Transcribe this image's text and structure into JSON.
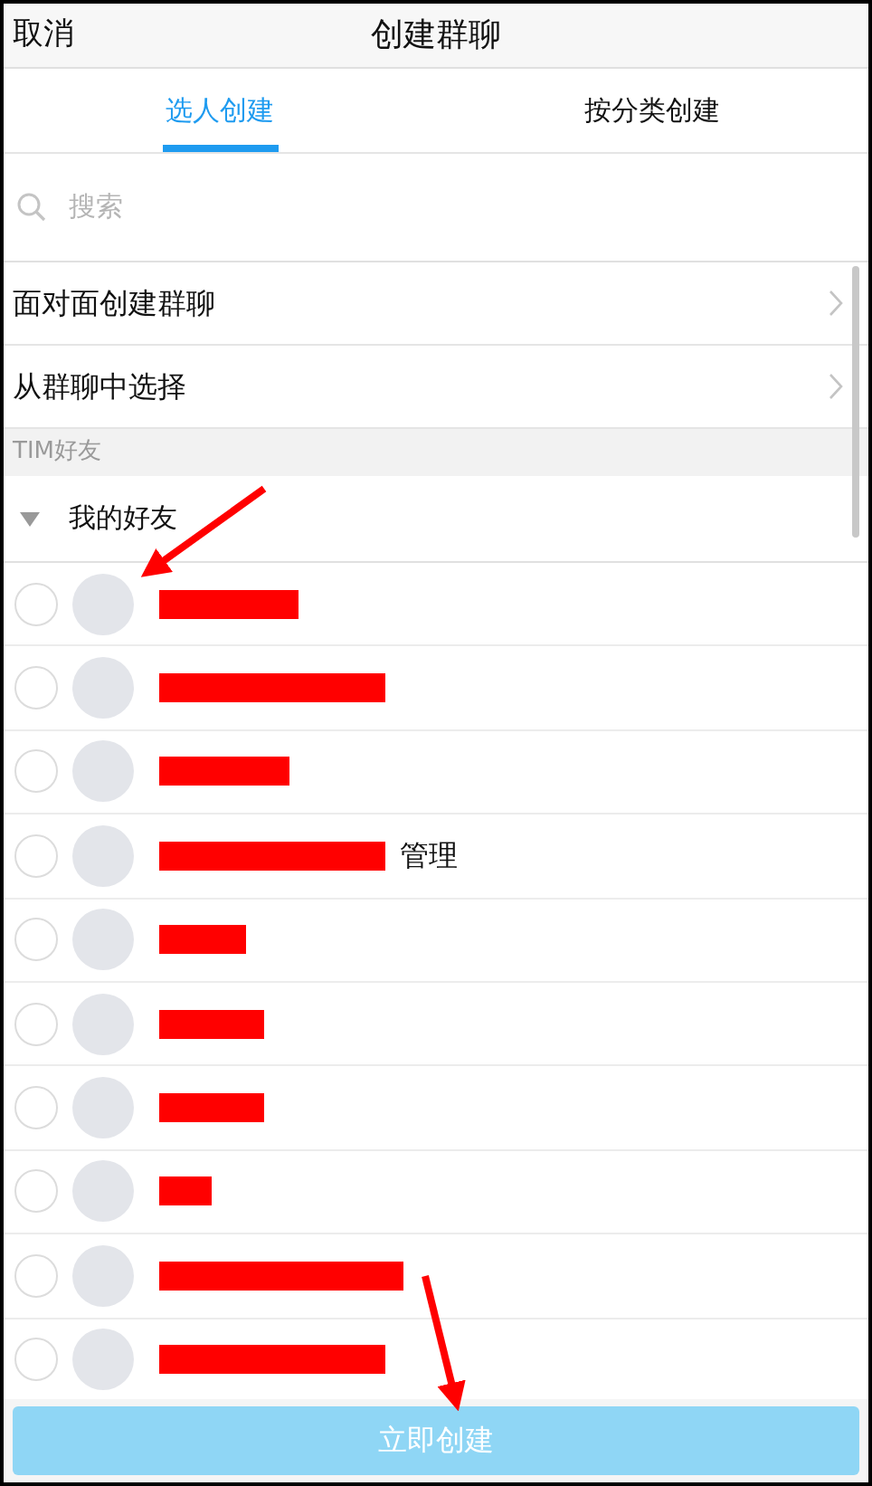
{
  "nav": {
    "cancel": "取消",
    "title": "创建群聊"
  },
  "tabs": [
    {
      "label": "选人创建",
      "selected": true
    },
    {
      "label": "按分类创建",
      "selected": false
    }
  ],
  "search": {
    "placeholder": "搜索"
  },
  "menu_items": [
    {
      "label": "面对面创建群聊"
    },
    {
      "label": "从群聊中选择"
    }
  ],
  "section_header": "TIM好友",
  "group": {
    "label": "我的好友",
    "expanded": true
  },
  "contacts": [
    {
      "selected": false
    },
    {
      "selected": false
    },
    {
      "selected": false
    },
    {
      "selected": false,
      "visible_text": "管理"
    },
    {
      "selected": false
    },
    {
      "selected": false
    },
    {
      "selected": false
    },
    {
      "selected": false
    },
    {
      "selected": false
    },
    {
      "selected": false
    }
  ],
  "create_button": {
    "label": "立即创建",
    "disabled": true
  }
}
